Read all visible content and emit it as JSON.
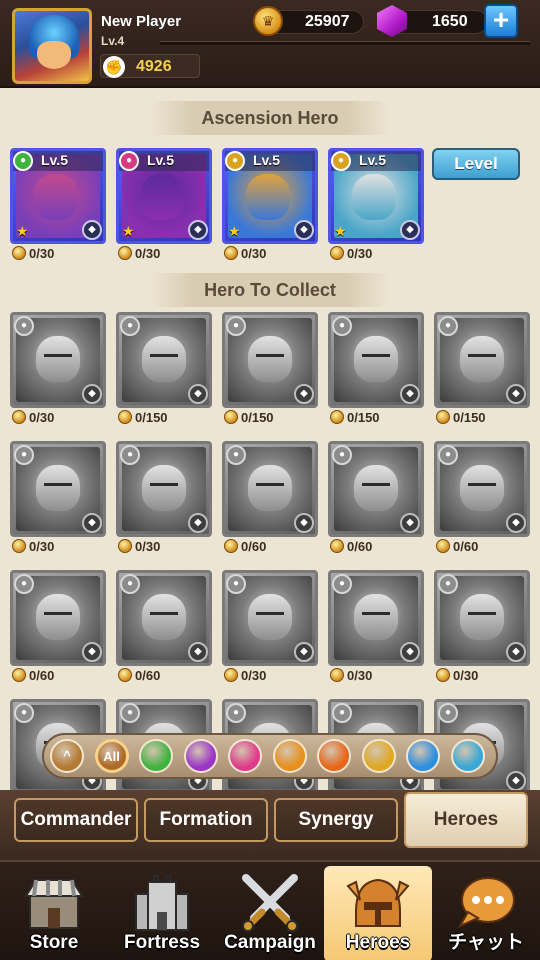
{
  "player": {
    "name": "New Player",
    "level": "Lv.4",
    "power": "4926"
  },
  "currency": {
    "gold": "25907",
    "gems": "1650"
  },
  "buttons": {
    "level": "Level",
    "add_gems": "+"
  },
  "sections": {
    "ascension": "Ascension Hero",
    "collect": "Hero To Collect"
  },
  "ascension_heroes": [
    {
      "level": "Lv.5",
      "shards": "0/30",
      "class_color": "#3fb33f",
      "role_icon": "bow-icon"
    },
    {
      "level": "Lv.5",
      "shards": "0/30",
      "class_color": "#d63a82",
      "role_icon": "staff-icon"
    },
    {
      "level": "Lv.5",
      "shards": "0/30",
      "class_color": "#d9a21f",
      "role_icon": "hammer-icon"
    },
    {
      "level": "Lv.5",
      "shards": "0/30",
      "class_color": "#d9a21f",
      "role_icon": "staff-icon"
    }
  ],
  "collect_heroes": [
    {
      "shards": "0/30"
    },
    {
      "shards": "0/150"
    },
    {
      "shards": "0/150"
    },
    {
      "shards": "0/150"
    },
    {
      "shards": "0/150"
    },
    {
      "shards": "0/30"
    },
    {
      "shards": "0/30"
    },
    {
      "shards": "0/60"
    },
    {
      "shards": "0/60"
    },
    {
      "shards": "0/60"
    },
    {
      "shards": "0/60"
    },
    {
      "shards": "0/60"
    },
    {
      "shards": "0/30"
    },
    {
      "shards": "0/30"
    },
    {
      "shards": "0/30"
    }
  ],
  "filters": [
    {
      "label": "^",
      "name": "filter-collapse",
      "color": "#b57a32"
    },
    {
      "label": "All",
      "name": "filter-all",
      "color": "#b06a26"
    },
    {
      "label": "",
      "name": "filter-green",
      "color": "#3fb33f"
    },
    {
      "label": "",
      "name": "filter-purple",
      "color": "#9a35c7"
    },
    {
      "label": "",
      "name": "filter-pink",
      "color": "#e03a8a"
    },
    {
      "label": "",
      "name": "filter-orange",
      "color": "#e8901a"
    },
    {
      "label": "",
      "name": "filter-fire",
      "color": "#e8661a"
    },
    {
      "label": "",
      "name": "filter-gold",
      "color": "#e0a822"
    },
    {
      "label": "",
      "name": "filter-water",
      "color": "#2c8fe0"
    },
    {
      "label": "",
      "name": "filter-skull",
      "color": "#38a8d8"
    }
  ],
  "subtabs": {
    "commander": "Commander",
    "formation": "Formation",
    "synergy": "Synergy",
    "heroes": "Heroes"
  },
  "nav": {
    "store": "Store",
    "fortress": "Fortress",
    "campaign": "Campaign",
    "heroes": "Heroes",
    "chat": "チャット"
  }
}
